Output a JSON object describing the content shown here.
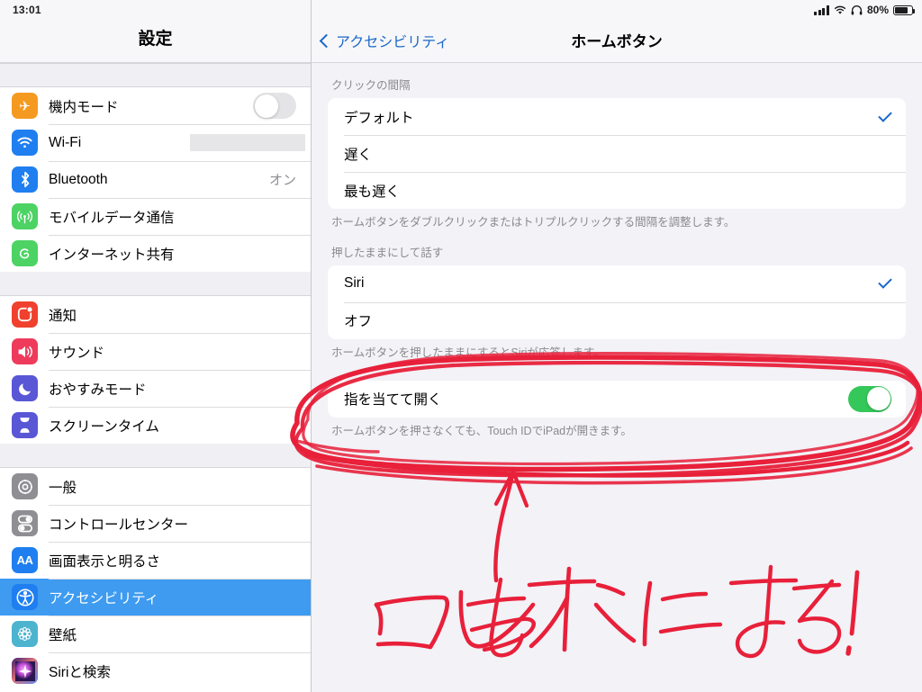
{
  "status_bar": {
    "time": "13:01",
    "battery_percent": "80%",
    "icons": [
      "cellular-signal-icon",
      "wifi-icon",
      "headphones-icon",
      "battery-icon"
    ]
  },
  "sidebar": {
    "title": "設定",
    "groups": [
      {
        "items": [
          {
            "label": "機内モード",
            "icon": "airplane-icon",
            "icon_class": "ic-airplane",
            "glyph": "✈",
            "accessory": "toggle",
            "toggle_on": false
          },
          {
            "label": "Wi-Fi",
            "icon": "wifi-icon",
            "icon_class": "ic-wifi",
            "glyph": "",
            "accessory": "redacted",
            "value": ""
          },
          {
            "label": "Bluetooth",
            "icon": "bluetooth-icon",
            "icon_class": "ic-bt",
            "glyph": "",
            "accessory": "value",
            "value": "オン"
          },
          {
            "label": "モバイルデータ通信",
            "icon": "cellular-icon",
            "icon_class": "ic-cell",
            "glyph": "",
            "accessory": "none",
            "value": ""
          },
          {
            "label": "インターネット共有",
            "icon": "personal-hotspot-icon",
            "icon_class": "ic-hotspot",
            "glyph": "",
            "accessory": "none",
            "value": ""
          }
        ]
      },
      {
        "items": [
          {
            "label": "通知",
            "icon": "notifications-icon",
            "icon_class": "ic-notif",
            "glyph": "",
            "accessory": "none",
            "value": ""
          },
          {
            "label": "サウンド",
            "icon": "sounds-icon",
            "icon_class": "ic-sound",
            "glyph": "",
            "accessory": "none",
            "value": ""
          },
          {
            "label": "おやすみモード",
            "icon": "moon-icon",
            "icon_class": "ic-dnd",
            "glyph": "",
            "accessory": "none",
            "value": ""
          },
          {
            "label": "スクリーンタイム",
            "icon": "hourglass-icon",
            "icon_class": "ic-screentime",
            "glyph": "",
            "accessory": "none",
            "value": ""
          }
        ]
      },
      {
        "items": [
          {
            "label": "一般",
            "icon": "gear-icon",
            "icon_class": "ic-general",
            "glyph": "",
            "accessory": "none",
            "value": ""
          },
          {
            "label": "コントロールセンター",
            "icon": "control-center-icon",
            "icon_class": "ic-cc",
            "glyph": "",
            "accessory": "none",
            "value": ""
          },
          {
            "label": "画面表示と明るさ",
            "icon": "display-brightness-icon",
            "icon_class": "ic-display",
            "glyph": "AA",
            "accessory": "none",
            "value": ""
          },
          {
            "label": "アクセシビリティ",
            "icon": "accessibility-icon",
            "icon_class": "ic-access",
            "glyph": "",
            "accessory": "none",
            "value": "",
            "selected": true
          },
          {
            "label": "壁紙",
            "icon": "wallpaper-icon",
            "icon_class": "ic-wall",
            "glyph": "",
            "accessory": "none",
            "value": ""
          },
          {
            "label": "Siriと検索",
            "icon": "siri-icon",
            "icon_class": "ic-siri",
            "glyph": "",
            "accessory": "none",
            "value": ""
          }
        ]
      }
    ]
  },
  "detail": {
    "back_label": "アクセシビリティ",
    "title": "ホームボタン",
    "sections": [
      {
        "header": "クリックの間隔",
        "rows": [
          {
            "label": "デフォルト",
            "checked": true
          },
          {
            "label": "遅く",
            "checked": false
          },
          {
            "label": "最も遅く",
            "checked": false
          }
        ],
        "footer": "ホームボタンをダブルクリックまたはトリプルクリックする間隔を調整します。"
      },
      {
        "header": "押したままにして話す",
        "rows": [
          {
            "label": "Siri",
            "checked": true
          },
          {
            "label": "オフ",
            "checked": false
          }
        ],
        "footer": "ホームボタンを押したままにするとSiriが応答します。"
      },
      {
        "header": "",
        "rows": [
          {
            "label": "指を当てて開く",
            "toggle": true,
            "toggle_on": true
          }
        ],
        "footer": "ホームボタンを押さなくても、Touch IDでiPadが開きます。"
      }
    ]
  },
  "annotation": {
    "text": "コレをオンにする!",
    "color": "#e8203a",
    "shapes": [
      "ellipse-circle",
      "up-arrow",
      "handwritten-text"
    ]
  },
  "colors": {
    "accent_blue": "#1a68c9",
    "selection_blue": "#3e9bf0",
    "toggle_green": "#34c759",
    "annotation_red": "#e8203a"
  }
}
